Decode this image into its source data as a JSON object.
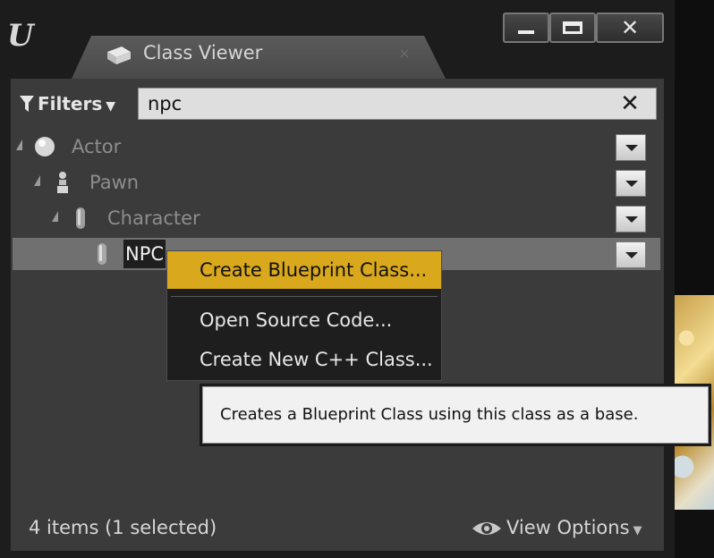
{
  "window": {
    "tab_title": "Class Viewer",
    "tab_close": "×",
    "minimize_icon": "minimize-icon",
    "maximize_icon": "maximize-icon",
    "close_glyph": "✕"
  },
  "toolbar": {
    "filters_label": "Filters",
    "search_value": "npc",
    "clear_glyph": "✕"
  },
  "tree": [
    {
      "label": "Actor",
      "icon": "sphere-icon",
      "depth": 0,
      "selected": false
    },
    {
      "label": "Pawn",
      "icon": "pawn-icon",
      "depth": 1,
      "selected": false
    },
    {
      "label": "Character",
      "icon": "capsule-icon",
      "depth": 2,
      "selected": false
    },
    {
      "label": "NPC",
      "icon": "capsule-icon",
      "depth": 3,
      "selected": true
    }
  ],
  "context_menu": {
    "items": [
      {
        "label": "Create Blueprint Class...",
        "highlighted": true
      },
      {
        "label": "Open Source Code..."
      },
      {
        "label": "Create New C++ Class..."
      }
    ]
  },
  "tooltip": "Creates a Blueprint Class using this class as a base.",
  "status": {
    "item_count": "4 items (1 selected)",
    "view_options_label": "View Options"
  },
  "colors": {
    "highlight": "#d9a81c",
    "panel": "#3b3b3b",
    "selected_row": "#707070"
  }
}
